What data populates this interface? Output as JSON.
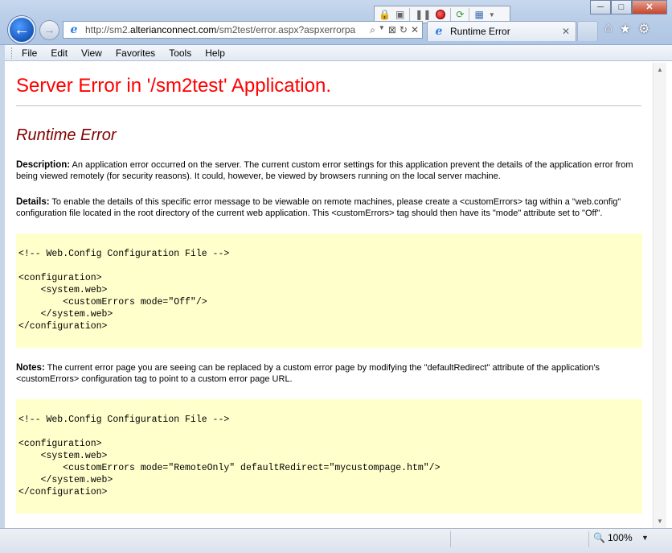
{
  "window": {
    "minimize": "─",
    "maximize": "□",
    "close": "✕"
  },
  "address": {
    "scheme": "http://sm2.",
    "host": "alterianconnect.com",
    "path": "/sm2test/error.aspx?aspxerrorpa"
  },
  "tab": {
    "title": "Runtime Error"
  },
  "menu": [
    "File",
    "Edit",
    "View",
    "Favorites",
    "Tools",
    "Help"
  ],
  "page": {
    "title": "Server Error in '/sm2test' Application.",
    "subtitle": "Runtime Error",
    "description_label": "Description:",
    "description_text": " An application error occurred on the server. The current custom error settings for this application prevent the details of the application error from being viewed remotely (for security reasons). It could, however, be viewed by browsers running on the local server machine.",
    "details_label": "Details:",
    "details_text": " To enable the details of this specific error message to be viewable on remote machines, please create a <customErrors> tag within a \"web.config\" configuration file located in the root directory of the current web application. This <customErrors> tag should then have its \"mode\" attribute set to \"Off\".",
    "code1": "<!-- Web.Config Configuration File -->\n\n<configuration>\n    <system.web>\n        <customErrors mode=\"Off\"/>\n    </system.web>\n</configuration>",
    "notes_label": "Notes:",
    "notes_text": " The current error page you are seeing can be replaced by a custom error page by modifying the \"defaultRedirect\" attribute of the application's <customErrors> configuration tag to point to a custom error page URL.",
    "code2": "<!-- Web.Config Configuration File -->\n\n<configuration>\n    <system.web>\n        <customErrors mode=\"RemoteOnly\" defaultRedirect=\"mycustompage.htm\"/>\n    </system.web>\n</configuration>"
  },
  "status": {
    "zoom": "100%"
  },
  "colors": {
    "title_red": "#ff0000",
    "subtitle_maroon": "#800000",
    "code_bg": "#ffffcc"
  }
}
